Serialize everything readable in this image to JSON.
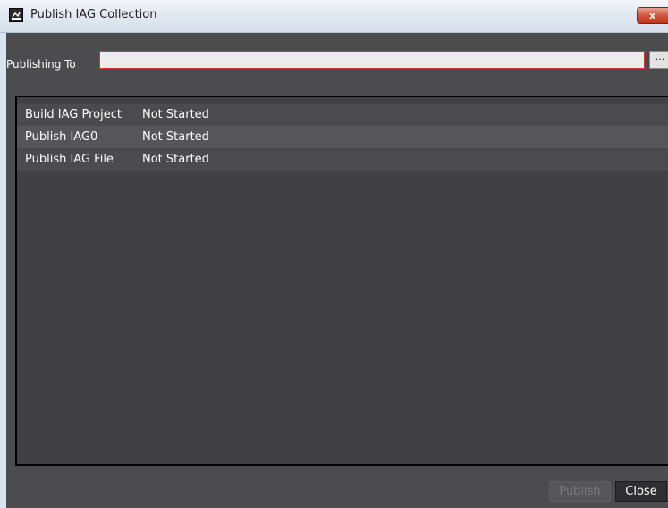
{
  "window": {
    "title": "Publish IAG Collection",
    "close_glyph": "x",
    "app_icon": "application-icon"
  },
  "form": {
    "publishing_to_label": "Publishing To",
    "publishing_to_value": "",
    "publishing_to_placeholder": "",
    "browse_label": "..."
  },
  "steps": [
    {
      "name": "Build IAG Project",
      "status": "Not Started"
    },
    {
      "name": "Publish IAG0",
      "status": "Not Started"
    },
    {
      "name": "Publish IAG File",
      "status": "Not Started"
    }
  ],
  "buttons": {
    "publish_label": "Publish",
    "publish_enabled": false,
    "close_label": "Close"
  },
  "colors": {
    "body_background": "#4c4c4f",
    "input_error_border": "#d6343a",
    "close_button_red": "#c23519"
  }
}
